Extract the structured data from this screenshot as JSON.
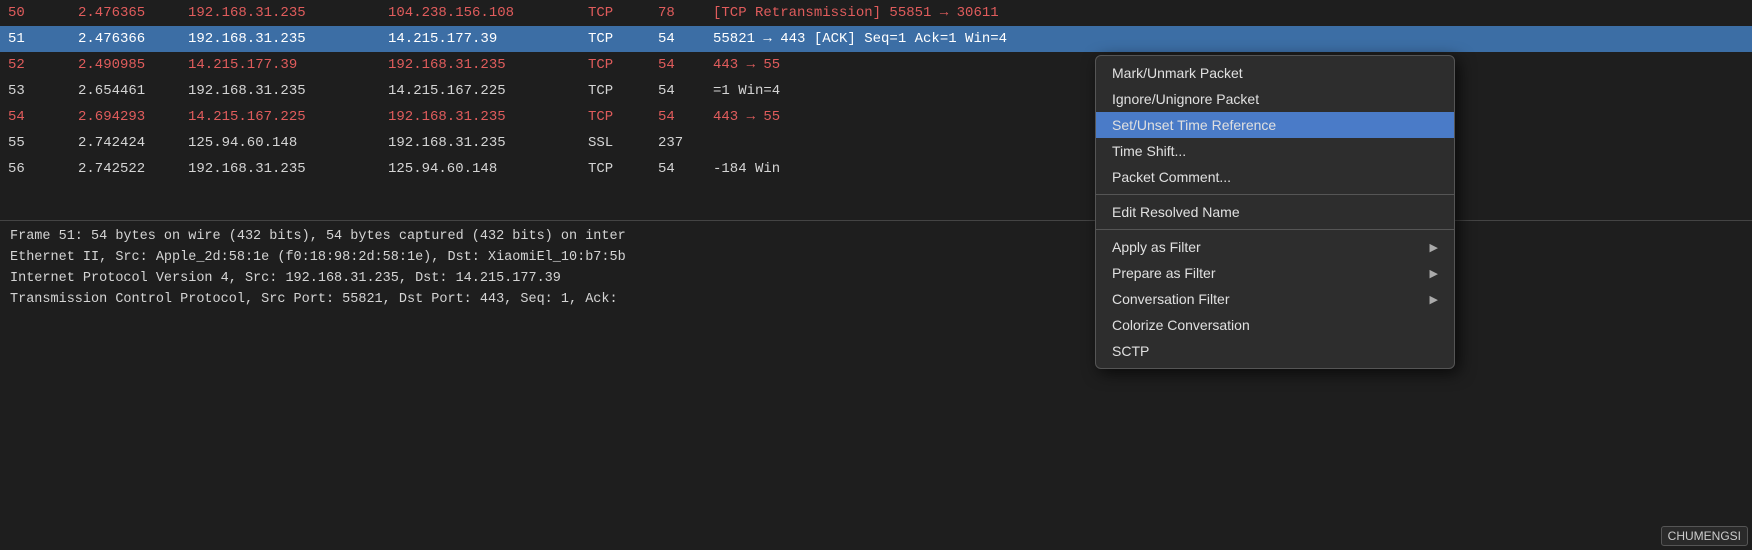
{
  "packets": [
    {
      "no": "50",
      "time": "2.476365",
      "src": "192.168.31.235",
      "dst": "104.238.156.108",
      "proto": "TCP",
      "len": "78",
      "info": "[TCP Retransmission] 55851 → 30611",
      "style": "red"
    },
    {
      "no": "51",
      "time": "2.476366",
      "src": "192.168.31.235",
      "dst": "14.215.177.39",
      "proto": "TCP",
      "len": "54",
      "info": "55821 → 443 [ACK] Seq=1 Ack=1 Win=4",
      "style": "selected"
    },
    {
      "no": "52",
      "time": "2.490985",
      "src": "14.215.177.39",
      "dst": "192.168.31.235",
      "proto": "TCP",
      "len": "54",
      "info": "443 → 55",
      "style": "red"
    },
    {
      "no": "53",
      "time": "2.654461",
      "src": "192.168.31.235",
      "dst": "14.215.167.225",
      "proto": "TCP",
      "len": "54",
      "info": "=1 Win=4",
      "style": "normal"
    },
    {
      "no": "54",
      "time": "2.694293",
      "src": "14.215.167.225",
      "dst": "192.168.31.235",
      "proto": "TCP",
      "len": "54",
      "info": "443 → 55",
      "style": "red"
    },
    {
      "no": "55",
      "time": "2.742424",
      "src": "125.94.60.148",
      "dst": "192.168.31.235",
      "proto": "SSL",
      "len": "237",
      "info": "",
      "style": "normal"
    },
    {
      "no": "56",
      "time": "2.742522",
      "src": "192.168.31.235",
      "dst": "125.94.60.148",
      "proto": "TCP",
      "len": "54",
      "info": "-184 Win",
      "style": "normal"
    }
  ],
  "detail_lines": [
    "Frame 51: 54 bytes on wire (432 bits), 54 bytes captured (432 bits) on inter",
    "Ethernet II, Src: Apple_2d:58:1e (f0:18:98:2d:58:1e), Dst: XiaomiEl_10:b7:5b",
    "Internet Protocol Version 4, Src: 192.168.31.235, Dst: 14.215.177.39",
    "Transmission Control Protocol, Src Port: 55821, Dst Port: 443, Seq: 1, Ack:"
  ],
  "context_menu": {
    "items": [
      {
        "label": "Mark/Unmark Packet",
        "has_sub": false,
        "highlighted": false
      },
      {
        "label": "Ignore/Unignore Packet",
        "has_sub": false,
        "highlighted": false
      },
      {
        "label": "Set/Unset Time Reference",
        "has_sub": false,
        "highlighted": true
      },
      {
        "label": "Time Shift...",
        "has_sub": false,
        "highlighted": false
      },
      {
        "label": "Packet Comment...",
        "has_sub": false,
        "highlighted": false
      },
      {
        "divider": true
      },
      {
        "label": "Edit Resolved Name",
        "has_sub": false,
        "highlighted": false
      },
      {
        "divider": true
      },
      {
        "label": "Apply as Filter",
        "has_sub": true,
        "highlighted": false
      },
      {
        "label": "Prepare as Filter",
        "has_sub": true,
        "highlighted": false
      },
      {
        "label": "Conversation Filter",
        "has_sub": true,
        "highlighted": false
      },
      {
        "label": "Colorize Conversation",
        "has_sub": false,
        "highlighted": false
      },
      {
        "label": "SCTP",
        "has_sub": false,
        "highlighted": false
      }
    ]
  },
  "watermark": {
    "text": "CHUMENGSI"
  }
}
